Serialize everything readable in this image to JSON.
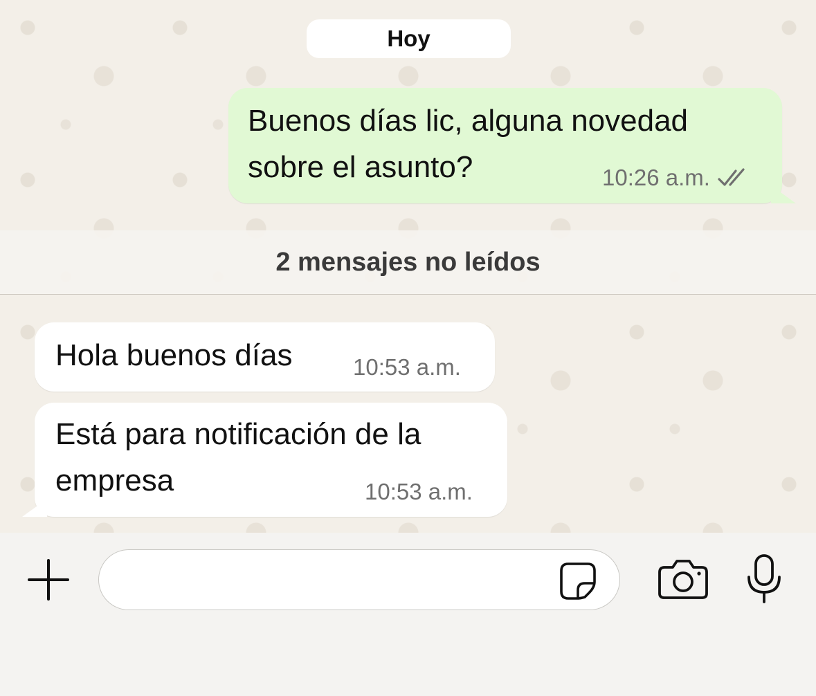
{
  "chat": {
    "day_label": "Hoy",
    "unread_label": "2 mensajes no leídos",
    "messages": [
      {
        "direction": "outgoing",
        "text": "Buenos días lic, alguna novedad\nsobre el asunto?",
        "time": "10:26 a.m.",
        "status_icon": "double-check-icon"
      },
      {
        "direction": "incoming",
        "text": "Hola buenos días",
        "time": "10:53 a.m."
      },
      {
        "direction": "incoming",
        "text": "Está para notificación de la\nempresa",
        "time": "10:53 a.m."
      }
    ]
  },
  "composer": {
    "attach_icon": "plus-icon",
    "sticker_icon": "sticker-icon",
    "camera_icon": "camera-icon",
    "mic_icon": "microphone-icon",
    "input_value": ""
  },
  "colors": {
    "outgoing_bubble": "#e1f9d4",
    "incoming_bubble": "#ffffff",
    "chat_background": "#f3efe8"
  }
}
